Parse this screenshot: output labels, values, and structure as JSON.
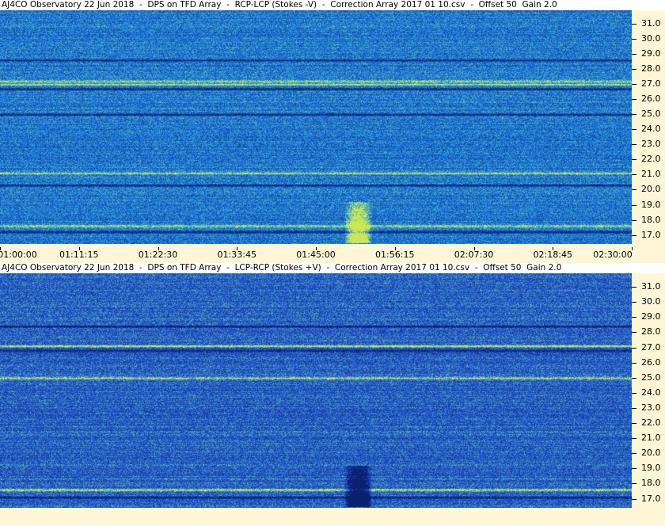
{
  "colors": {
    "panel_background": "#fef6d6",
    "title_background": "#ffffff",
    "rcp_lcp_base": "#1f6fe0",
    "lcp_rcp_base": "#2356d2",
    "burst_bright": "#cfe84a",
    "burst_dark": "#0a1a6a"
  },
  "chart_data": [
    {
      "type": "heatmap",
      "title": "AJ4CO Observatory 22 Jun 2018  -  DPS on TFD Array  -  RCP-LCP (Stokes -V)  -  Correction Array 2017 01 10.csv  -  Offset 50  Gain 2.0",
      "xlabel": "",
      "ylabel": "",
      "x_ticks": [
        "01:00:00",
        "01:11:15",
        "01:22:30",
        "01:33:45",
        "01:45:00",
        "01:56:15",
        "02:07:30",
        "02:18:45",
        "02:30:00"
      ],
      "y_ticks": [
        "31.0",
        "30.0",
        "29.0",
        "28.0",
        "27.0",
        "26.0",
        "25.0",
        "24.0",
        "23.0",
        "22.0",
        "21.0",
        "20.0",
        "19.0",
        "18.0",
        "17.0"
      ],
      "ylim": [
        16.4,
        31.9
      ],
      "xlim": [
        "01:00:00",
        "02:30:00"
      ],
      "colormap": "blue-cyan-yellow",
      "features": {
        "burst_time_range": [
          "01:49:00",
          "01:53:00"
        ],
        "burst_freq_range": [
          16.5,
          19.2
        ],
        "bright_bands_mhz": [
          27.0,
          27.2,
          21.1,
          17.6
        ],
        "dark_bands_mhz": [
          28.6,
          26.7,
          25.0,
          20.3,
          17.2
        ]
      }
    },
    {
      "type": "heatmap",
      "title": "AJ4CO Observatory 22 Jun 2018  -  DPS on TFD Array  -  LCP-RCP (Stokes +V)  -  Correction Array 2017 01 10.csv  -  Offset 50  Gain 2.0",
      "xlabel": "",
      "ylabel": "",
      "x_ticks": [],
      "y_ticks": [
        "31.0",
        "30.0",
        "29.0",
        "28.0",
        "27.0",
        "26.0",
        "25.0",
        "24.0",
        "23.0",
        "22.0",
        "21.0",
        "20.0",
        "19.0",
        "18.0",
        "17.0"
      ],
      "ylim": [
        16.4,
        31.9
      ],
      "xlim": [
        "01:00:00",
        "02:30:00"
      ],
      "colormap": "blue-cyan-yellow",
      "features": {
        "burst_time_range": [
          "01:49:00",
          "01:53:00"
        ],
        "burst_freq_range": [
          16.5,
          19.2
        ],
        "bright_bands_mhz": [
          27.1,
          25.0,
          17.6
        ],
        "dark_bands_mhz": [
          28.4,
          26.8,
          17.1
        ]
      }
    }
  ]
}
